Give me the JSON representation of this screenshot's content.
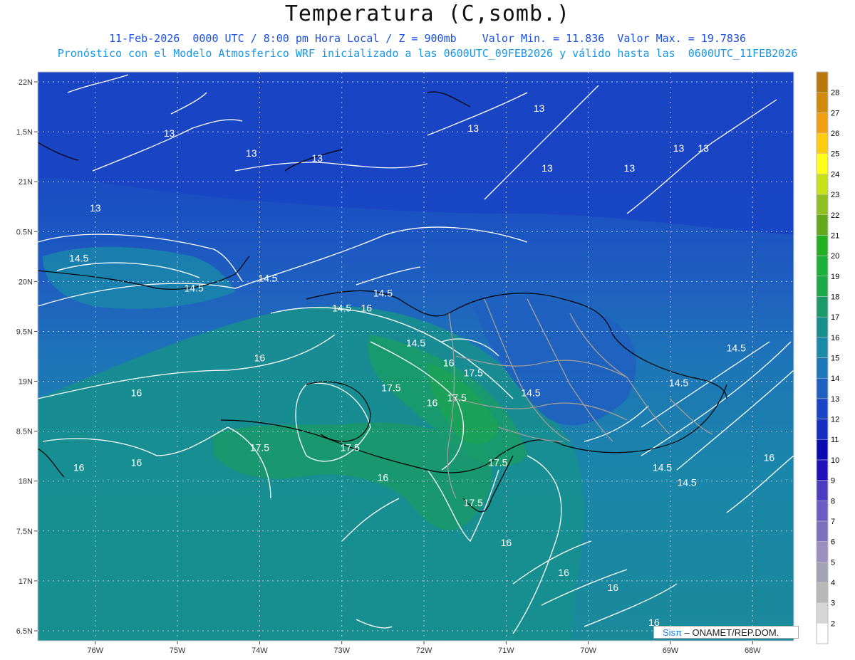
{
  "title": "Temperatura (C,somb.)",
  "subtitle_line1": "11-Feb-2026  0000 UTC / 8:00 pm Hora Local / Z = 900mb    Valor Min. = 11.836  Valor Max. = 19.7836",
  "subtitle_line2": "Pronóstico con el Modelo Atmosferico WRF inicializado a las 0600UTC_09FEB2026 y válido hasta las  0600UTC_11FEB2026",
  "credit": {
    "logo": "Sisπ",
    "text": " – ONAMET/REP.DOM."
  },
  "map": {
    "lon_range": [
      -76.7,
      -67.5
    ],
    "lat_range": [
      16.4,
      22.1
    ],
    "lon_ticks": [
      {
        "value": -76,
        "label": "76W"
      },
      {
        "value": -75,
        "label": "75W"
      },
      {
        "value": -74,
        "label": "74W"
      },
      {
        "value": -73,
        "label": "73W"
      },
      {
        "value": -72,
        "label": "72W"
      },
      {
        "value": -71,
        "label": "71W"
      },
      {
        "value": -70,
        "label": "70W"
      },
      {
        "value": -69,
        "label": "69W"
      },
      {
        "value": -68,
        "label": "68W"
      }
    ],
    "lat_ticks": [
      {
        "value": 22,
        "label": "22N"
      },
      {
        "value": 21.5,
        "label": "1.5N"
      },
      {
        "value": 21,
        "label": "21N"
      },
      {
        "value": 20.5,
        "label": "0.5N"
      },
      {
        "value": 20,
        "label": "20N"
      },
      {
        "value": 19.5,
        "label": "9.5N"
      },
      {
        "value": 19,
        "label": "19N"
      },
      {
        "value": 18.5,
        "label": "8.5N"
      },
      {
        "value": 18,
        "label": "18N"
      },
      {
        "value": 17.5,
        "label": "7.5N"
      },
      {
        "value": 17,
        "label": "17N"
      },
      {
        "value": 16.5,
        "label": "6.5N"
      }
    ],
    "contour_labels": [
      {
        "lon": -71.4,
        "lat": 21.5,
        "text": "13"
      },
      {
        "lon": -70.6,
        "lat": 21.7,
        "text": "13"
      },
      {
        "lon": -75.1,
        "lat": 21.45,
        "text": "13"
      },
      {
        "lon": -74.1,
        "lat": 21.25,
        "text": "13"
      },
      {
        "lon": -73.3,
        "lat": 21.2,
        "text": "13"
      },
      {
        "lon": -70.5,
        "lat": 21.1,
        "text": "13"
      },
      {
        "lon": -69.5,
        "lat": 21.1,
        "text": "13"
      },
      {
        "lon": -68.9,
        "lat": 21.3,
        "text": "13"
      },
      {
        "lon": -68.6,
        "lat": 21.3,
        "text": "13"
      },
      {
        "lon": -76.0,
        "lat": 20.7,
        "text": "13"
      },
      {
        "lon": -76.2,
        "lat": 20.2,
        "text": "14.5"
      },
      {
        "lon": -74.8,
        "lat": 19.9,
        "text": "14.5"
      },
      {
        "lon": -73.9,
        "lat": 20.0,
        "text": "14.5"
      },
      {
        "lon": -72.5,
        "lat": 19.85,
        "text": "14.5"
      },
      {
        "lon": -73.0,
        "lat": 19.7,
        "text": "14.5"
      },
      {
        "lon": -72.7,
        "lat": 19.7,
        "text": "16"
      },
      {
        "lon": -74.0,
        "lat": 19.2,
        "text": "16"
      },
      {
        "lon": -75.5,
        "lat": 18.85,
        "text": "16"
      },
      {
        "lon": -72.1,
        "lat": 19.35,
        "text": "14.5"
      },
      {
        "lon": -71.7,
        "lat": 19.15,
        "text": "16"
      },
      {
        "lon": -71.4,
        "lat": 19.05,
        "text": "17.5"
      },
      {
        "lon": -72.4,
        "lat": 18.9,
        "text": "17.5"
      },
      {
        "lon": -71.6,
        "lat": 18.8,
        "text": "17.5"
      },
      {
        "lon": -71.9,
        "lat": 18.75,
        "text": "16"
      },
      {
        "lon": -70.7,
        "lat": 18.85,
        "text": "14.5"
      },
      {
        "lon": -68.9,
        "lat": 18.95,
        "text": "14.5"
      },
      {
        "lon": -68.2,
        "lat": 19.3,
        "text": "14.5"
      },
      {
        "lon": -74.0,
        "lat": 18.3,
        "text": "17.5"
      },
      {
        "lon": -72.9,
        "lat": 18.3,
        "text": "17.5"
      },
      {
        "lon": -71.1,
        "lat": 18.15,
        "text": "17.5"
      },
      {
        "lon": -72.5,
        "lat": 18.0,
        "text": "16"
      },
      {
        "lon": -76.2,
        "lat": 18.1,
        "text": "16"
      },
      {
        "lon": -75.5,
        "lat": 18.15,
        "text": "16"
      },
      {
        "lon": -69.1,
        "lat": 18.1,
        "text": "14.5"
      },
      {
        "lon": -68.8,
        "lat": 17.95,
        "text": "14.5"
      },
      {
        "lon": -67.8,
        "lat": 18.2,
        "text": "16"
      },
      {
        "lon": -71.4,
        "lat": 17.75,
        "text": "17.5"
      },
      {
        "lon": -71.0,
        "lat": 17.35,
        "text": "16"
      },
      {
        "lon": -70.3,
        "lat": 17.05,
        "text": "16"
      },
      {
        "lon": -69.7,
        "lat": 16.9,
        "text": "16"
      },
      {
        "lon": -69.2,
        "lat": 16.55,
        "text": "16"
      }
    ]
  },
  "colorbar": {
    "levels": [
      2,
      3,
      4,
      5,
      6,
      7,
      8,
      9,
      10,
      11,
      12,
      13,
      14,
      15,
      16,
      17,
      18,
      19,
      20,
      21,
      22,
      23,
      24,
      25,
      26,
      27,
      28
    ],
    "colors": [
      "#ffffff",
      "#d6d6d6",
      "#b8b8b8",
      "#a3a3b4",
      "#9b8fbf",
      "#7d6fbd",
      "#6a5cc0",
      "#4b3cc0",
      "#1f12b8",
      "#0a0ab0",
      "#1530c0",
      "#1a45c4",
      "#1f60c0",
      "#1e78b8",
      "#1a8aa8",
      "#178f8e",
      "#1a9a6a",
      "#1ea848",
      "#1cb03a",
      "#22b020",
      "#66a81c",
      "#8fbf20",
      "#c8e01a",
      "#ffff1a",
      "#ffcc10",
      "#f0a010",
      "#d08a0c",
      "#b8780c"
    ],
    "extends": "both"
  },
  "shading": {
    "base_colors": {
      "deep": "#1a45c4",
      "mid": "#1f60c0",
      "sea": "#1e78b8",
      "teal": "#1a8aa8",
      "green": "#178f8e",
      "land": "#1a9a6a"
    }
  }
}
